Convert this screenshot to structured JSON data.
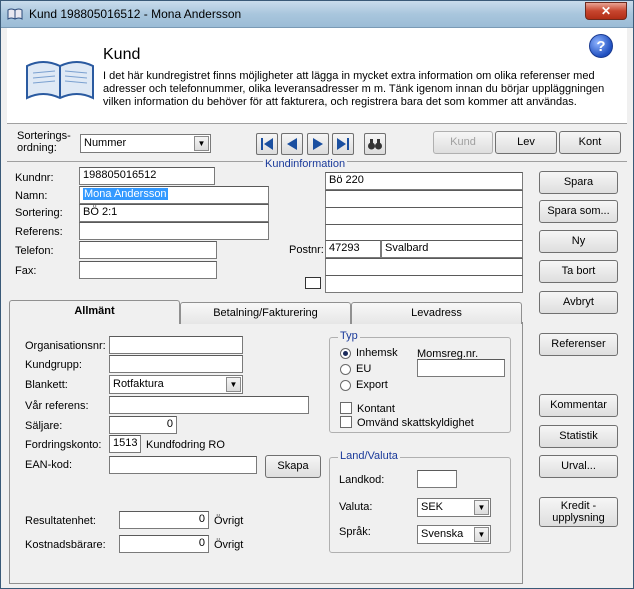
{
  "window": {
    "title": "Kund 198805016512 - Mona Andersson",
    "close": "✕"
  },
  "header": {
    "title": "Kund",
    "text": "I det här kundregistret finns möjligheter att lägga in mycket extra information om olika referenser med adresser och telefonnummer, olika leveransadresser m m. Tänk igenom innan du börjar uppläggningen vilken information du behöver för att fakturera, och registrera bara det som kommer att användas.",
    "help": "?"
  },
  "sort": {
    "label_line1": "Sorterings-",
    "label_line2": "ordning:",
    "value": "Nummer"
  },
  "toolbar": {
    "kund": "Kund",
    "lev": "Lev",
    "kont": "Kont",
    "kundinfo": "Kundinformation"
  },
  "form": {
    "kundnr_label": "Kundnr:",
    "kundnr": "198805016512",
    "namn_label": "Namn:",
    "namn": "Mona Andersson",
    "sortering_label": "Sortering:",
    "sortering": "BÖ 2:1",
    "referens_label": "Referens:",
    "referens": "",
    "telefon_label": "Telefon:",
    "telefon": "",
    "fax_label": "Fax:",
    "fax": "",
    "address1": "Bö 220",
    "postnr_label": "Postnr:",
    "postnr": "47293",
    "ort": "Svalbard"
  },
  "side_buttons": {
    "spara": "Spara",
    "spara_som": "Spara som...",
    "ny": "Ny",
    "ta_bort": "Ta bort",
    "avbryt": "Avbryt",
    "referenser": "Referenser",
    "kommentar": "Kommentar",
    "statistik": "Statistik",
    "urval": "Urval...",
    "kredit1": "Kredit -",
    "kredit2": "upplysning"
  },
  "tabs": {
    "allmant": "Allmänt",
    "betalning": "Betalning/Fakturering",
    "levadress": "Levadress"
  },
  "allmant": {
    "org_label": "Organisationsnr:",
    "org": "",
    "kundgrupp_label": "Kundgrupp:",
    "kundgrupp": "",
    "blankett_label": "Blankett:",
    "blankett": "Rotfaktura",
    "var_ref_label": "Vår referens:",
    "var_ref": "",
    "saljare_label": "Säljare:",
    "saljare": "0",
    "fordring_label": "Fordringskonto:",
    "fordring": "1513",
    "fordring_name": "Kundfodring RO",
    "ean_label": "EAN-kod:",
    "ean": "",
    "skapa": "Skapa",
    "resultat_label": "Resultatenhet:",
    "resultat": "0",
    "resultat_name": "Övrigt",
    "kostnad_label": "Kostnadsbärare:",
    "kostnad": "0",
    "kostnad_name": "Övrigt"
  },
  "typ": {
    "label": "Typ",
    "inhemsk": "Inhemsk",
    "eu": "EU",
    "export": "Export",
    "momsreg_label": "Momsreg.nr.",
    "momsreg": "",
    "kontant": "Kontant",
    "omvand": "Omvänd skattskyldighet"
  },
  "land": {
    "label": "Land/Valuta",
    "landkod_label": "Landkod:",
    "landkod": "",
    "valuta_label": "Valuta:",
    "valuta": "SEK",
    "sprak_label": "Språk:",
    "sprak": "Svenska"
  }
}
